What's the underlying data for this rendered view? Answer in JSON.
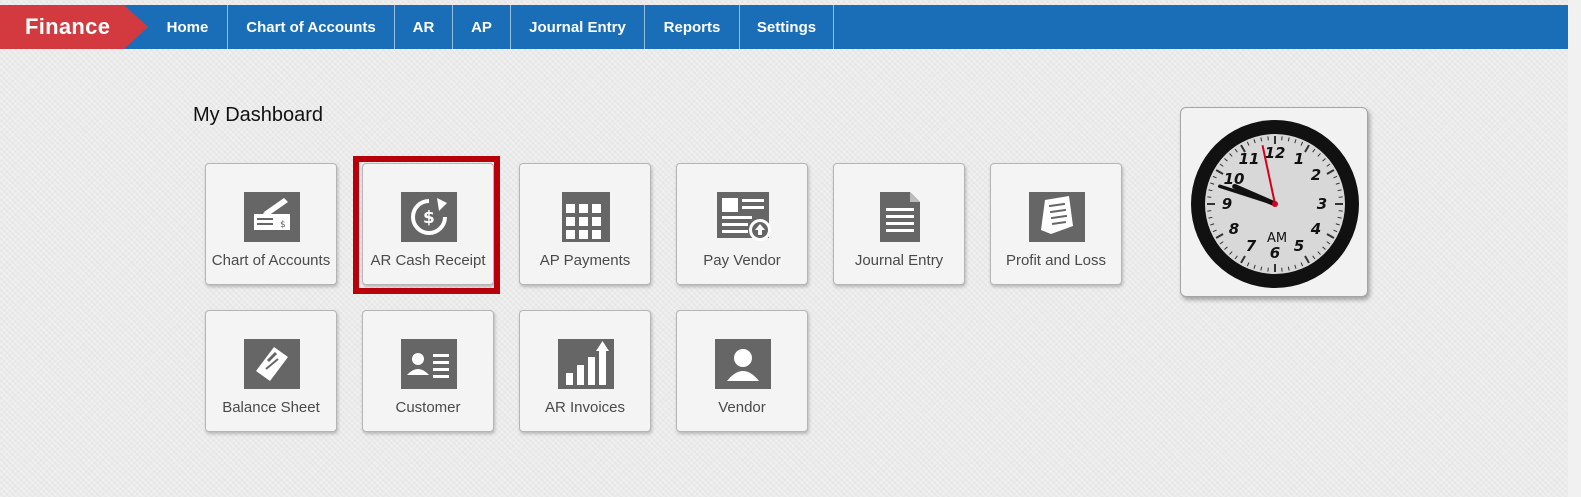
{
  "brand": "Finance",
  "nav": [
    {
      "label": "Home"
    },
    {
      "label": "Chart of Accounts"
    },
    {
      "label": "AR"
    },
    {
      "label": "AP"
    },
    {
      "label": "Journal Entry"
    },
    {
      "label": "Reports"
    },
    {
      "label": "Settings"
    }
  ],
  "dashboard": {
    "title": "My Dashboard",
    "tiles": [
      {
        "label": "Chart of Accounts",
        "icon": "check-writing-icon"
      },
      {
        "label": "AR Cash Receipt",
        "icon": "cash-receipt-icon"
      },
      {
        "label": "AP Payments",
        "icon": "calendar-grid-icon"
      },
      {
        "label": "Pay Vendor",
        "icon": "pay-vendor-icon"
      },
      {
        "label": "Journal Entry",
        "icon": "document-icon"
      },
      {
        "label": "Profit and Loss",
        "icon": "receipt-icon"
      },
      {
        "label": "Balance Sheet",
        "icon": "balance-sheet-icon"
      },
      {
        "label": "Customer",
        "icon": "contact-card-icon"
      },
      {
        "label": "AR Invoices",
        "icon": "bar-chart-icon"
      },
      {
        "label": "Vendor",
        "icon": "user-icon"
      }
    ]
  },
  "clock": {
    "numerals": [
      "12",
      "1",
      "2",
      "3",
      "4",
      "5",
      "6",
      "7",
      "8",
      "9",
      "10",
      "11"
    ],
    "meridiem": "AM",
    "time": "9:47",
    "second": 58
  },
  "colors": {
    "brand": "#d23a3f",
    "navbar": "#1a6eb8",
    "icon": "#666666",
    "highlight": "#b8000b",
    "second_hand": "#d0021b"
  }
}
